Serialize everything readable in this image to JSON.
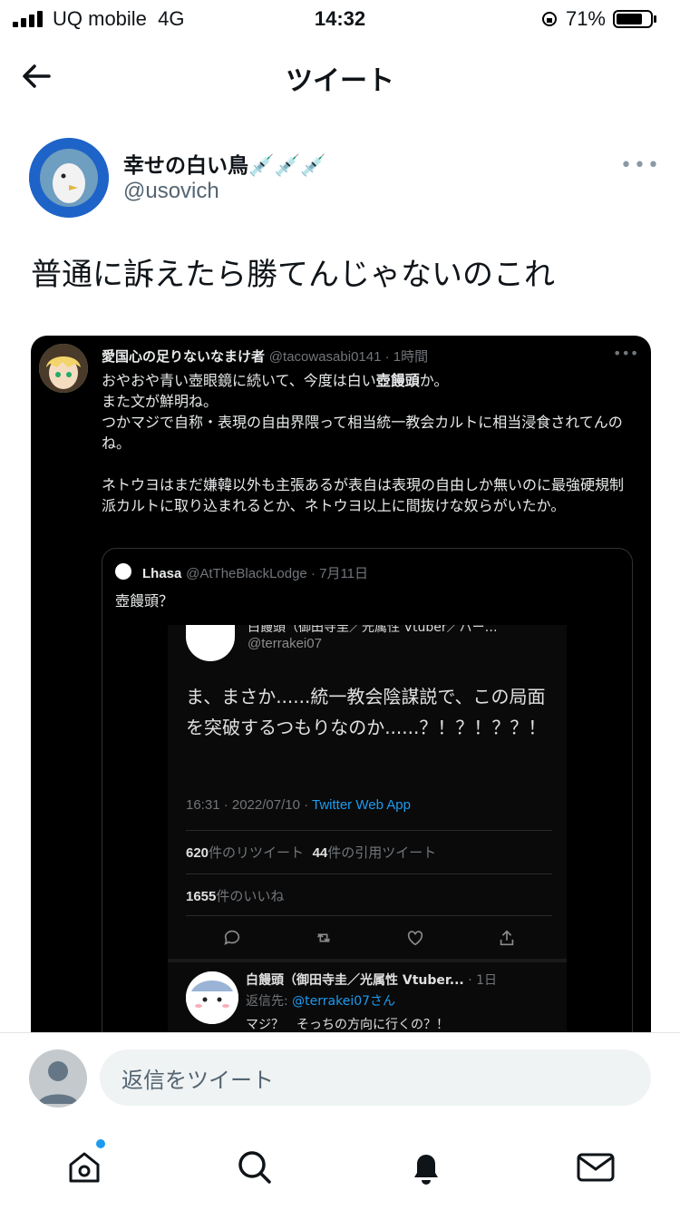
{
  "status": {
    "carrier": "UQ mobile",
    "network": "4G",
    "time": "14:32",
    "battery": "71%",
    "battery_level": 0.71
  },
  "header": {
    "title": "ツイート"
  },
  "author": {
    "name": "幸せの白い鳥💉💉💉",
    "handle": "@usovich"
  },
  "tweet": {
    "text": "普通に訴えたら勝てんじゃないのこれ"
  },
  "screenshot": {
    "name": "愛国心の足りないなまけ者",
    "handle_time": "@tacowasabi0141 · 1時間",
    "body_1": "おやおや青い壺眼鏡に続いて、今度は白い",
    "body_bold": "壺饅頭",
    "body_2": "か。\nまた文が鮮明ね。\nつかマジで自称・表現の自由界隈って相当統一教会カルトに相当浸食されてんのね。\n\nネトウヨはまだ嫌韓以外も主張あるが表自は表現の自由しか無いのに最強硬規制派カルトに取り込まれるとか、ネトウヨ以上に間抜けな奴らがいたか。",
    "quote": {
      "name": "Lhasa",
      "handle_date": "@AtTheBlackLodge · 7月11日",
      "text": "壺饅頭？",
      "inner": {
        "name": "白饅頭（御田寺圭／光属性 Vtuber／バー…",
        "handle": "@terrakei07",
        "text": "ま、まさか......統一教会陰謀説で、この局面を突破するつもりなのか......？！？！？？！",
        "meta": "16:31 · 2022/07/10 · ",
        "source": "Twitter Web App",
        "retweets_num": "620",
        "retweets_label": "件のリツイート",
        "quotes_num": "44",
        "quotes_label": "件の引用ツイート",
        "likes_num": "1655",
        "likes_label": "件のいいね",
        "reply_name": "白饅頭（御田寺圭／光属性 Vtuber...",
        "reply_time": " · 1日",
        "reply_to_label": "返信先: ",
        "reply_to_handle": "@terrakei07さん",
        "reply_text": "マジ？　そっちの方向に行くの？！"
      }
    }
  },
  "reply": {
    "placeholder": "返信をツイート"
  },
  "colors": {
    "accent": "#1d9bf0",
    "text": "#0f1419",
    "muted": "#536471"
  }
}
